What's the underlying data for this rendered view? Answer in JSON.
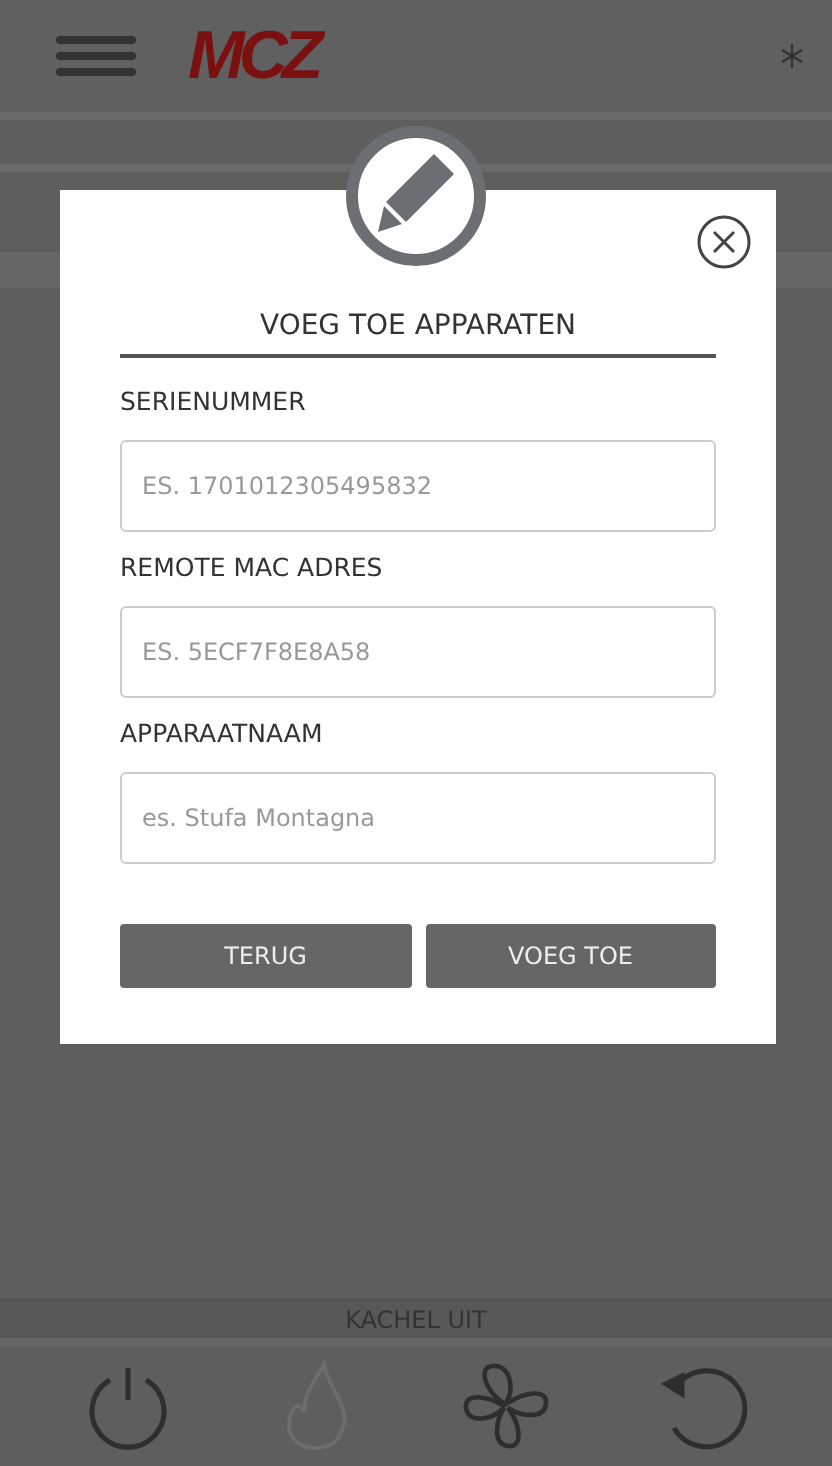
{
  "header": {
    "logo": "MCZ"
  },
  "dialog": {
    "title": "VOEG TOE APPARATEN",
    "fields": [
      {
        "label": "SERIENUMMER",
        "placeholder": "ES. 1701012305495832"
      },
      {
        "label": "REMOTE MAC ADRES",
        "placeholder": "ES. 5ECF7F8E8A58"
      },
      {
        "label": "APPARAATNAAM",
        "placeholder": "es. Stufa Montagna"
      }
    ],
    "buttons": [
      "TERUG",
      "VOEG TOE"
    ]
  },
  "status_bar": {
    "text": "KACHEL UIT"
  },
  "controls": [
    {
      "kind": "power",
      "disabled": false
    },
    {
      "kind": "flame",
      "disabled": true
    },
    {
      "kind": "fan",
      "disabled": false
    },
    {
      "kind": "reset",
      "disabled": false
    }
  ]
}
